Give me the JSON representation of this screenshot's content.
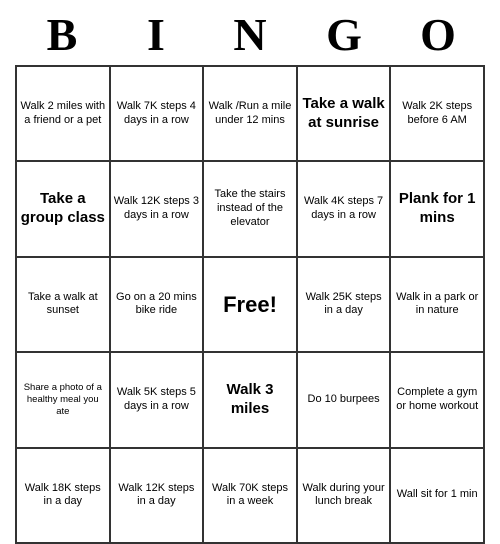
{
  "header": {
    "letters": [
      "B",
      "I",
      "N",
      "G",
      "O"
    ]
  },
  "cells": [
    {
      "text": "Walk 2 miles with a friend or a pet",
      "style": "normal"
    },
    {
      "text": "Walk 7K steps 4 days in a row",
      "style": "normal"
    },
    {
      "text": "Walk /Run a mile under 12 mins",
      "style": "normal"
    },
    {
      "text": "Take a walk at sunrise",
      "style": "large"
    },
    {
      "text": "Walk 2K steps before 6 AM",
      "style": "normal"
    },
    {
      "text": "Take a group class",
      "style": "large"
    },
    {
      "text": "Walk 12K steps 3 days in a row",
      "style": "normal"
    },
    {
      "text": "Take the stairs instead of the elevator",
      "style": "normal"
    },
    {
      "text": "Walk 4K steps 7 days in a row",
      "style": "normal"
    },
    {
      "text": "Plank for 1 mins",
      "style": "large"
    },
    {
      "text": "Take a walk at sunset",
      "style": "normal"
    },
    {
      "text": "Go on a 20 mins bike ride",
      "style": "normal"
    },
    {
      "text": "Free!",
      "style": "free"
    },
    {
      "text": "Walk 25K steps in a day",
      "style": "normal"
    },
    {
      "text": "Walk in a park or in nature",
      "style": "normal"
    },
    {
      "text": "Share a photo of a healthy meal you ate",
      "style": "small"
    },
    {
      "text": "Walk 5K steps 5 days in a row",
      "style": "normal"
    },
    {
      "text": "Walk 3 miles",
      "style": "large"
    },
    {
      "text": "Do 10 burpees",
      "style": "normal"
    },
    {
      "text": "Complete a gym or home workout",
      "style": "normal"
    },
    {
      "text": "Walk 18K steps in a day",
      "style": "normal"
    },
    {
      "text": "Walk 12K steps in a day",
      "style": "normal"
    },
    {
      "text": "Walk 70K steps in a week",
      "style": "normal"
    },
    {
      "text": "Walk during your lunch break",
      "style": "normal"
    },
    {
      "text": "Wall sit for 1 min",
      "style": "normal"
    }
  ]
}
